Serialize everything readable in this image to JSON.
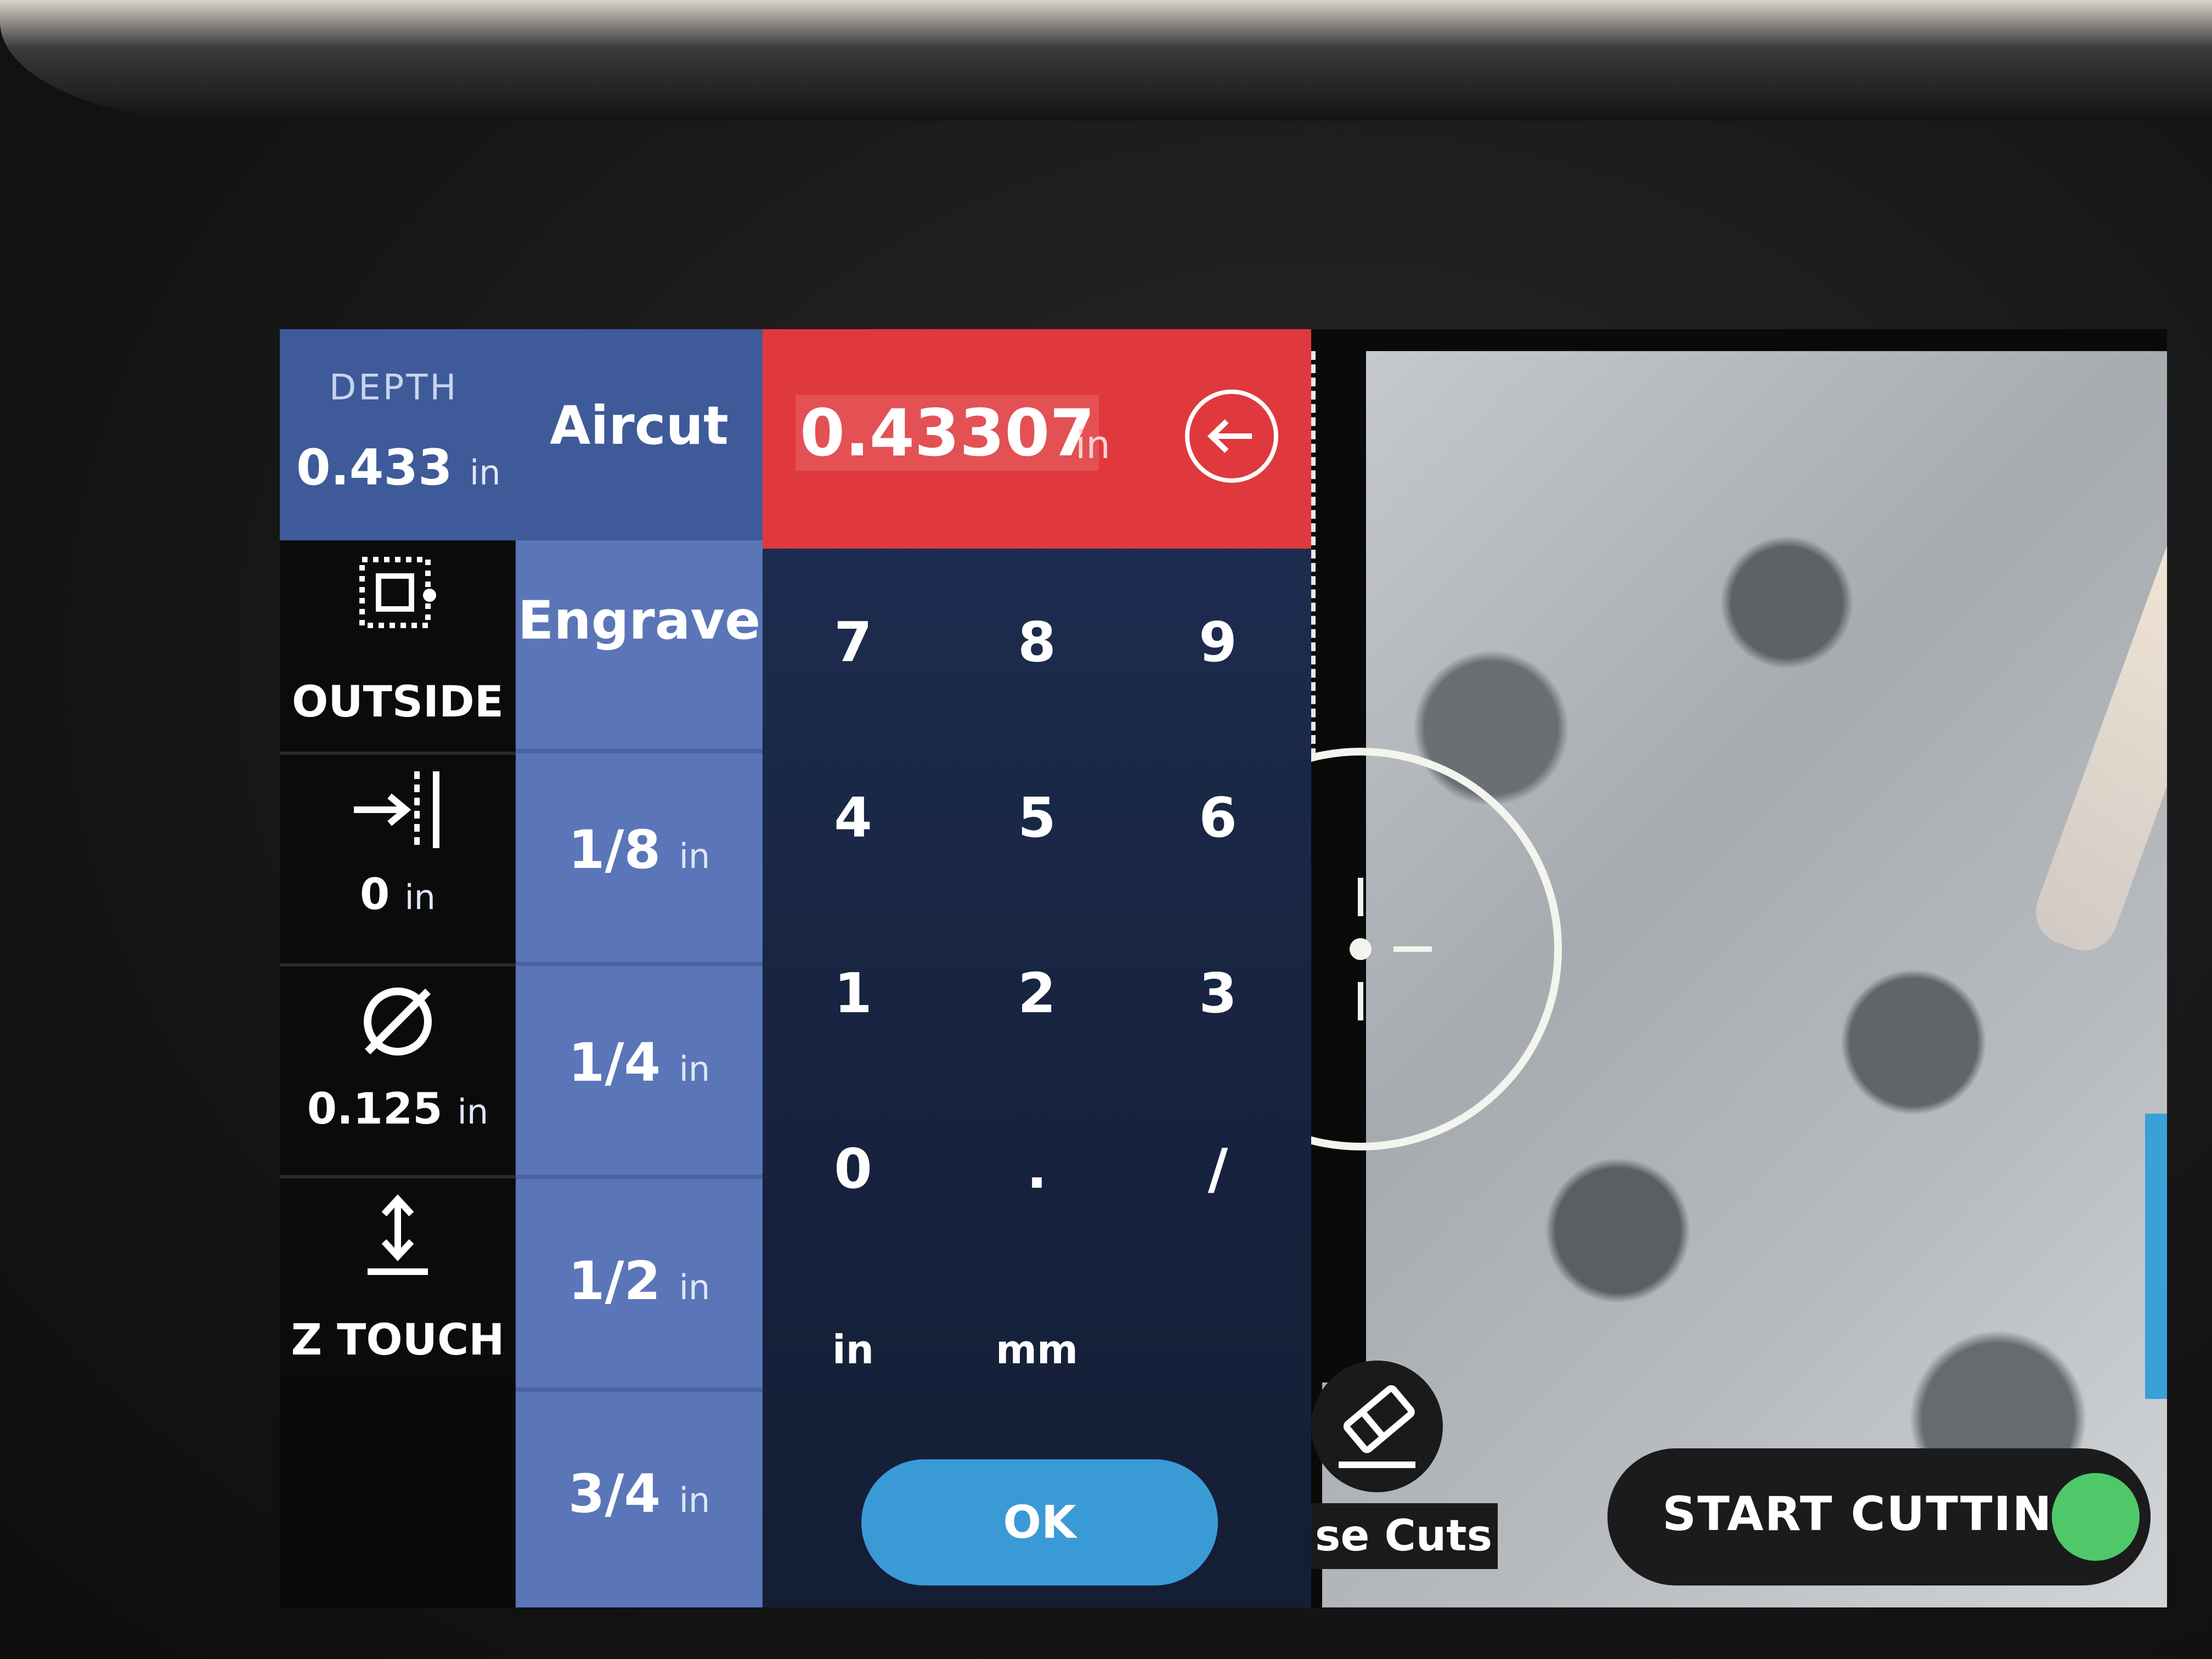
{
  "depth": {
    "label": "DEPTH",
    "value": "0.433",
    "unit": "in"
  },
  "side_menu": [
    {
      "name": "OUTSIDE",
      "icon": "outside-cut-icon"
    },
    {
      "value": "0",
      "unit": "in",
      "icon": "offset-icon"
    },
    {
      "value": "0.125",
      "unit": "in",
      "icon": "diameter-icon"
    },
    {
      "name": "Z TOUCH",
      "icon": "z-touch-icon"
    }
  ],
  "modes": [
    {
      "label": "Aircut"
    },
    {
      "label": "Engrave"
    },
    {
      "value": "1/8",
      "unit": "in"
    },
    {
      "value": "1/4",
      "unit": "in"
    },
    {
      "value": "1/2",
      "unit": "in"
    },
    {
      "value": "3/4",
      "unit": "in"
    }
  ],
  "input": {
    "value": "0.43307",
    "unit": "in",
    "backspace_icon": "backspace-arrow-icon"
  },
  "keypad": {
    "keys": [
      "7",
      "8",
      "9",
      "4",
      "5",
      "6",
      "1",
      "2",
      "3",
      "0",
      ".",
      "/"
    ],
    "units": [
      "in",
      "mm"
    ],
    "ok_label": "OK"
  },
  "erase": {
    "label": "se Cuts",
    "icon": "eraser-icon"
  },
  "start": {
    "label": "START CUTTING",
    "status_color": "#4fc86a"
  },
  "colors": {
    "accent_red": "#e0393d",
    "panel_blue": "#3e5a99",
    "mode_blue": "#5a76b8",
    "ok_blue": "#3a9ad6"
  }
}
